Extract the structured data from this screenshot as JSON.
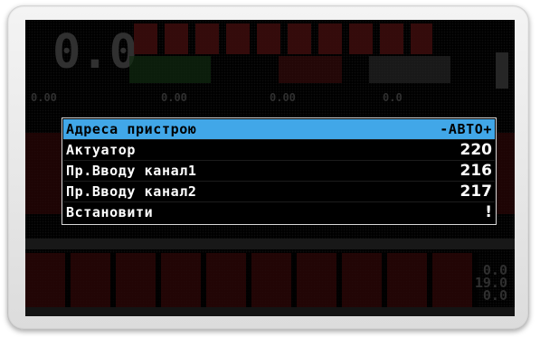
{
  "background": {
    "speed_readout": "0.0",
    "small_readouts": [
      "0.00",
      "0.00",
      "0.00",
      "0.0"
    ],
    "right_readouts": [
      "0.0",
      "19.0",
      "0.0"
    ]
  },
  "menu": {
    "items": [
      {
        "label": "Адреса пристрою",
        "value": "-АВТО+",
        "selected": true
      },
      {
        "label": "Актуатор",
        "value": "220",
        "selected": false
      },
      {
        "label": "Пр.Вводу канал1",
        "value": "216",
        "selected": false
      },
      {
        "label": "Пр.Вводу канал2",
        "value": "217",
        "selected": false
      },
      {
        "label": "Встановити",
        "value": "!",
        "selected": false
      }
    ]
  },
  "colors": {
    "highlight": "#41a7e8",
    "screen_bg": "#000000",
    "text": "#ffffff"
  }
}
